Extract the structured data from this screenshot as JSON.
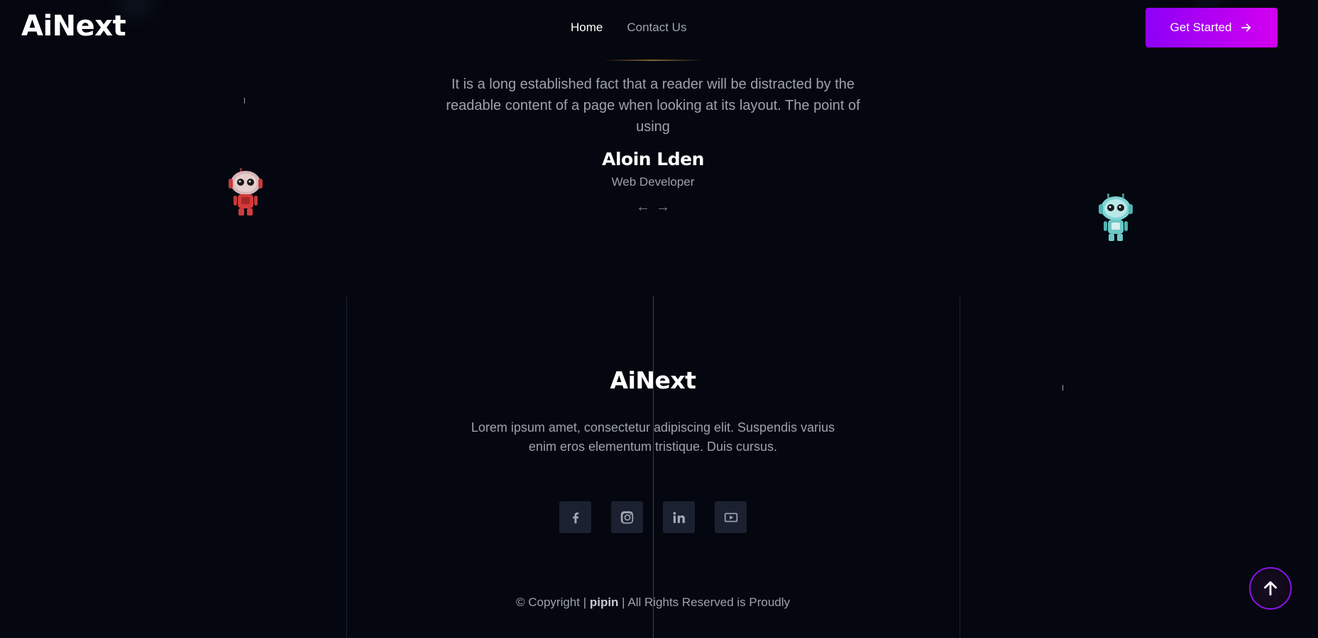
{
  "header": {
    "logo": "AiNext",
    "nav": [
      {
        "label": "Home",
        "active": true
      },
      {
        "label": "Contact Us",
        "active": false
      }
    ],
    "cta_label": "Get Started",
    "cta_icon": "arrow-right-icon"
  },
  "testimonial": {
    "quote": "It is a long established fact that a reader will be distracted by the readable content of a page when looking at its layout. The point of using",
    "author_name": "Aloin Lden",
    "author_role": "Web Developer",
    "prev_icon": "←",
    "next_icon": "→"
  },
  "footer": {
    "logo": "AiNext",
    "description": "Lorem ipsum amet, consectetur adipiscing elit. Suspendis varius enim eros elementum tristique. Duis cursus.",
    "socials": [
      "facebook-icon",
      "instagram-icon",
      "linkedin-icon",
      "youtube-icon"
    ],
    "copyright_prefix": "© Copyright | ",
    "copyright_brand": "pipin",
    "copyright_suffix": " | All Rights Reserved is Proudly"
  },
  "colors": {
    "background": "#04070f",
    "accent_start": "#8d00f5",
    "accent_end": "#d400f0"
  }
}
